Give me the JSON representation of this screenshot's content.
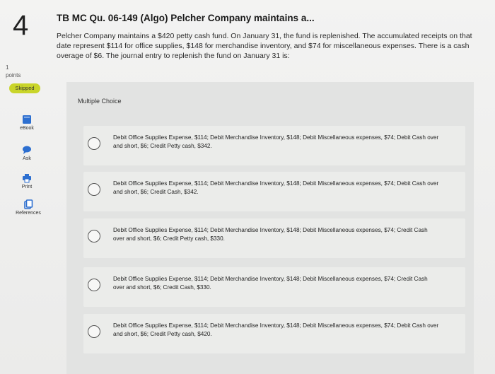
{
  "question": {
    "number": "4",
    "points_value": "1",
    "points_label": "points",
    "status_badge": "Skipped",
    "title": "TB MC Qu. 06-149 (Algo) Pelcher Company maintains a...",
    "stem": "Pelcher Company maintains a $420 petty cash fund. On January 31, the fund is replenished. The accumulated receipts on that date represent $114 for office supplies, $148 for merchandise inventory, and $74 for miscellaneous expenses. There is a cash overage of $6. The journal entry to replenish the fund on January 31 is:"
  },
  "tools": [
    {
      "label": "eBook",
      "icon": "book-icon"
    },
    {
      "label": "Ask",
      "icon": "speech-bubble-icon"
    },
    {
      "label": "Print",
      "icon": "printer-icon"
    },
    {
      "label": "References",
      "icon": "copy-icon"
    }
  ],
  "multiple_choice": {
    "label": "Multiple Choice",
    "options": [
      "Debit Office Supplies Expense, $114; Debit Merchandise Inventory, $148; Debit Miscellaneous expenses, $74; Debit Cash over and short, $6; Credit Petty cash, $342.",
      "Debit Office Supplies Expense, $114; Debit Merchandise Inventory, $148; Debit Miscellaneous expenses, $74; Debit Cash over and short, $6; Credit Cash, $342.",
      "Debit Office Supplies Expense, $114; Debit Merchandise Inventory, $148; Debit Miscellaneous expenses, $74; Credit Cash over and short, $6; Credit Petty cash, $330.",
      "Debit Office Supplies Expense, $114; Debit Merchandise Inventory, $148; Debit Miscellaneous expenses, $74; Credit Cash over and short, $6; Credit Cash, $330.",
      "Debit Office Supplies Expense, $114; Debit Merchandise Inventory, $148; Debit Miscellaneous expenses, $74; Debit Cash over and short, $6; Credit Petty cash, $420."
    ]
  },
  "colors": {
    "skipped_badge": "#c9d52a",
    "icon_blue": "#2d6fd0"
  }
}
